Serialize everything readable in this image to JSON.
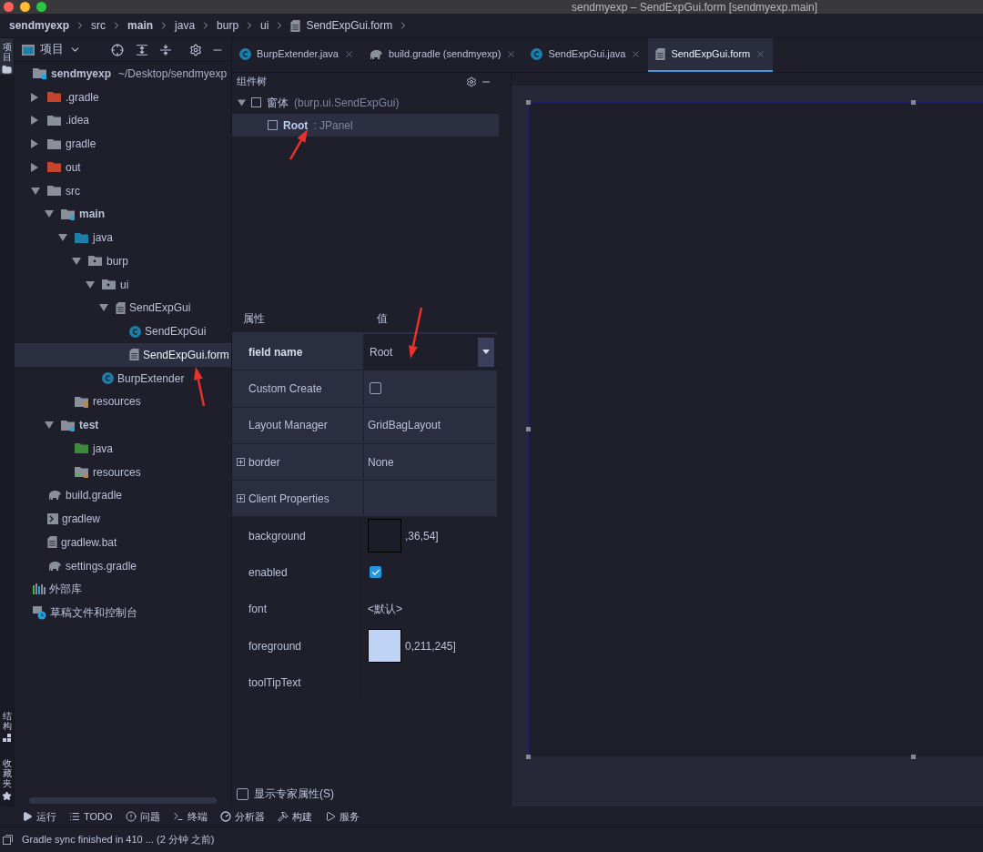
{
  "window": {
    "title": "sendmyexp – SendExpGui.form [sendmyexp.main]"
  },
  "breadcrumb": [
    {
      "label": "sendmyexp",
      "kind": "module"
    },
    {
      "label": "src",
      "kind": "folder"
    },
    {
      "label": "main",
      "kind": "module"
    },
    {
      "label": "java",
      "kind": "folder"
    },
    {
      "label": "burp",
      "kind": "folder"
    },
    {
      "label": "ui",
      "kind": "folder"
    },
    {
      "label": "SendExpGui.form",
      "kind": "form"
    }
  ],
  "left_strip": [
    {
      "label": "项目",
      "kind": "project"
    },
    {
      "label": "结构",
      "kind": "structure"
    },
    {
      "label": "收藏夹",
      "kind": "favorites"
    }
  ],
  "project_panel": {
    "title": "项目",
    "tree": [
      {
        "label": "sendmyexp",
        "detail": "~/Desktop/sendmyexp",
        "kind": "module",
        "selected": false,
        "children": [
          {
            "label": ".gradle",
            "kind": "folder-excluded",
            "expanded": false,
            "selected": false
          },
          {
            "label": ".idea",
            "kind": "folder",
            "expanded": false,
            "selected": false
          },
          {
            "label": "gradle",
            "kind": "folder",
            "expanded": false,
            "selected": false
          },
          {
            "label": "out",
            "kind": "folder-excluded",
            "expanded": false,
            "selected": false
          },
          {
            "label": "src",
            "kind": "folder",
            "expanded": true,
            "selected": false,
            "children": [
              {
                "label": "main",
                "kind": "module",
                "expanded": true,
                "selected": false,
                "children": [
                  {
                    "label": "java",
                    "kind": "source-folder",
                    "expanded": true,
                    "selected": false,
                    "children": [
                      {
                        "label": "burp",
                        "kind": "package",
                        "expanded": true,
                        "selected": false,
                        "children": [
                          {
                            "label": "ui",
                            "kind": "package",
                            "expanded": true,
                            "selected": false,
                            "children": [
                              {
                                "label": "SendExpGui",
                                "kind": "form",
                                "expanded": true,
                                "selected": false,
                                "children": [
                                  {
                                    "label": "SendExpGui",
                                    "kind": "class",
                                    "selected": false
                                  },
                                  {
                                    "label": "SendExpGui.form",
                                    "kind": "form",
                                    "selected": true
                                  }
                                ]
                              }
                            ]
                          },
                          {
                            "label": "BurpExtender",
                            "kind": "class",
                            "selected": false
                          }
                        ]
                      }
                    ]
                  },
                  {
                    "label": "resources",
                    "kind": "resources",
                    "selected": false
                  }
                ]
              },
              {
                "label": "test",
                "kind": "module",
                "expanded": true,
                "selected": false,
                "children": [
                  {
                    "label": "java",
                    "kind": "test-source",
                    "selected": false
                  },
                  {
                    "label": "resources",
                    "kind": "test-resources",
                    "selected": false
                  }
                ]
              }
            ]
          },
          {
            "label": "build.gradle",
            "kind": "gradle",
            "selected": false
          },
          {
            "label": "gradlew",
            "kind": "script",
            "selected": false
          },
          {
            "label": "gradlew.bat",
            "kind": "file",
            "selected": false
          },
          {
            "label": "settings.gradle",
            "kind": "gradle",
            "selected": false
          }
        ]
      },
      {
        "label": "外部库",
        "kind": "library",
        "selected": false
      },
      {
        "label": "草稿文件和控制台",
        "kind": "scratches",
        "selected": false
      }
    ]
  },
  "tabs": [
    {
      "label": "BurpExtender.java",
      "kind": "class",
      "selected": false
    },
    {
      "label": "build.gradle (sendmyexp)",
      "kind": "gradle",
      "selected": false
    },
    {
      "label": "SendExpGui.java",
      "kind": "class",
      "selected": false
    },
    {
      "label": "SendExpGui.form",
      "kind": "form",
      "selected": true
    }
  ],
  "component_tree": {
    "title": "组件树",
    "items": [
      {
        "label": "窗体",
        "type_label": "(burp.ui.SendExpGui)",
        "expanded": true,
        "selected": false,
        "children": [
          {
            "label": "Root",
            "type_label": ": JPanel",
            "selected": true
          }
        ]
      }
    ]
  },
  "properties": {
    "columns": [
      "属性",
      "值"
    ],
    "rows": [
      {
        "name": "field name",
        "kind": "dropdown",
        "value": "Root",
        "emphasized": true,
        "bold": true
      },
      {
        "name": "Custom Create",
        "kind": "checkbox",
        "checked": false,
        "emphasized": true,
        "bold": false
      },
      {
        "name": "Layout Manager",
        "kind": "text",
        "value": "GridBagLayout",
        "emphasized": true,
        "bold": false
      },
      {
        "name": "border",
        "kind": "text",
        "value": "None",
        "expandable": true,
        "emphasized": true,
        "bold": false
      },
      {
        "name": "Client Properties",
        "kind": "text",
        "expandable": true,
        "emphasized": true,
        "bold": false
      },
      {
        "name": "background",
        "kind": "color",
        "value": ",36,54]",
        "color": "#1b1d29",
        "emphasized": false,
        "bold": false
      },
      {
        "name": "enabled",
        "kind": "checkbox",
        "checked": true,
        "emphasized": false,
        "bold": false
      },
      {
        "name": "font",
        "kind": "text",
        "value": "<默认>",
        "emphasized": false,
        "bold": false
      },
      {
        "name": "foreground",
        "kind": "color",
        "value": "0,211,245]",
        "color": "#bfd3f5",
        "emphasized": false,
        "bold": false
      },
      {
        "name": "toolTipText",
        "kind": "text",
        "emphasized": false,
        "bold": false
      }
    ],
    "expert": {
      "label": "显示专家属性(S)",
      "checked": false
    }
  },
  "bottom_toolbar": [
    {
      "label": "运行",
      "kind": "run"
    },
    {
      "label": "TODO",
      "kind": "todo"
    },
    {
      "label": "问题",
      "kind": "problems"
    },
    {
      "label": "终端",
      "kind": "terminal"
    },
    {
      "label": "分析器",
      "kind": "profiler"
    },
    {
      "label": "构建",
      "kind": "build"
    },
    {
      "label": "服务",
      "kind": "services"
    }
  ],
  "status_bar": {
    "message": "Gradle sync finished in 410 ... (2 分钟 之前)"
  }
}
